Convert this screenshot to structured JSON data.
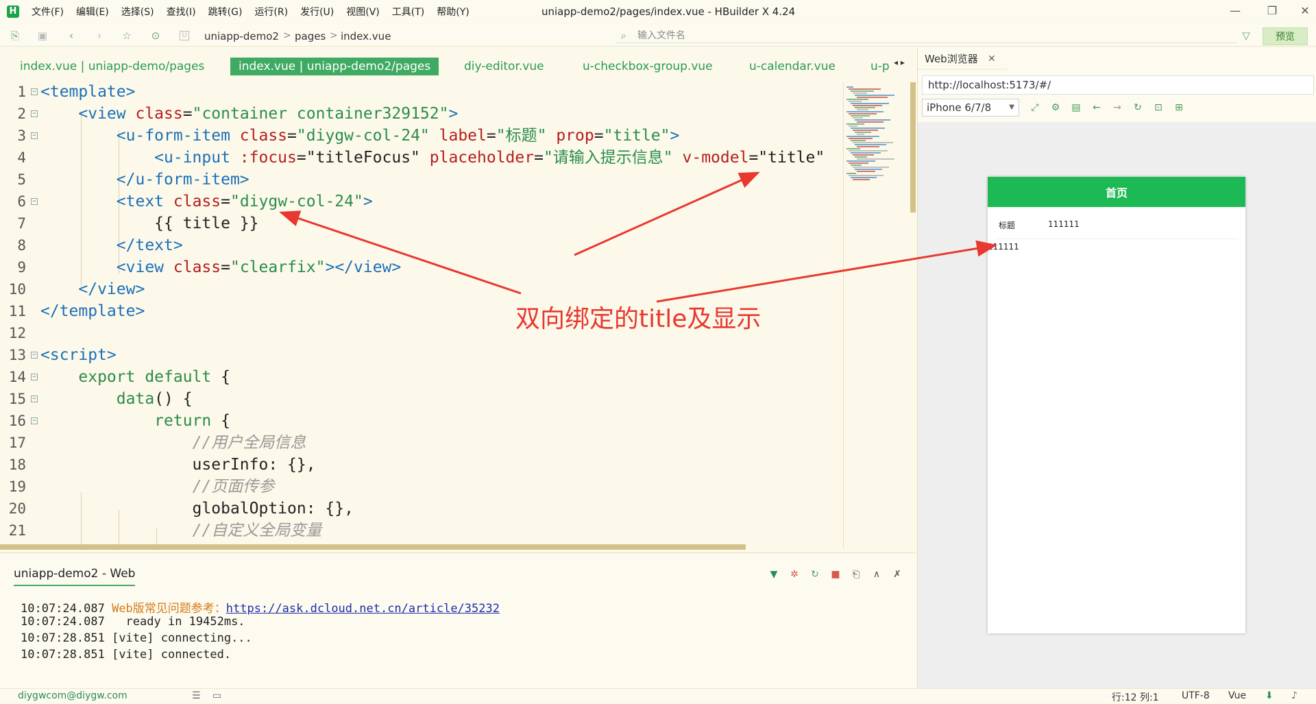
{
  "titlebar": {
    "logo": "H",
    "menu": [
      "文件(F)",
      "编辑(E)",
      "选择(S)",
      "查找(I)",
      "跳转(G)",
      "运行(R)",
      "发行(U)",
      "视图(V)",
      "工具(T)",
      "帮助(Y)"
    ],
    "window_title": "uniapp-demo2/pages/index.vue - HBuilder X 4.24",
    "minimize": "—",
    "restore": "❐",
    "close": "✕"
  },
  "toolbar": {
    "breadcrumb": [
      "uniapp-demo2",
      "pages",
      "index.vue"
    ],
    "breadcrumb_sep": ">",
    "search_placeholder": "输入文件名",
    "preview_label": "预览",
    "icons": [
      "new-file-icon",
      "save-icon",
      "back-icon",
      "forward-icon",
      "star-icon",
      "run-icon",
      "project-icon",
      "file-search-icon",
      "filter-icon"
    ]
  },
  "tabs": [
    {
      "label": "index.vue | uniapp-demo/pages",
      "active": false
    },
    {
      "label": "index.vue | uniapp-demo2/pages",
      "active": true
    },
    {
      "label": "diy-editor.vue",
      "active": false
    },
    {
      "label": "u-checkbox-group.vue",
      "active": false
    },
    {
      "label": "u-calendar.vue",
      "active": false
    },
    {
      "label": "u-p",
      "active": false
    }
  ],
  "tab_scroll": "◂ ▸",
  "code_lines": [
    {
      "n": "1",
      "fold": "⊟",
      "tokens": [
        [
          "tag",
          "<template>"
        ]
      ]
    },
    {
      "n": "2",
      "fold": "⊟",
      "tokens": [
        [
          "plain",
          "    "
        ],
        [
          "tag",
          "<view "
        ],
        [
          "attr",
          "class"
        ],
        [
          "plain",
          "="
        ],
        [
          "str",
          "\"container container329152\""
        ],
        [
          "tag",
          ">"
        ]
      ]
    },
    {
      "n": "3",
      "fold": "⊟",
      "tokens": [
        [
          "plain",
          "        "
        ],
        [
          "tag",
          "<u-form-item "
        ],
        [
          "attr",
          "class"
        ],
        [
          "plain",
          "="
        ],
        [
          "str",
          "\"diygw-col-24\""
        ],
        [
          "plain",
          " "
        ],
        [
          "attr",
          "label"
        ],
        [
          "plain",
          "="
        ],
        [
          "str",
          "\"标题\""
        ],
        [
          "plain",
          " "
        ],
        [
          "attr",
          "prop"
        ],
        [
          "plain",
          "="
        ],
        [
          "str",
          "\"title\""
        ],
        [
          "tag",
          ">"
        ]
      ]
    },
    {
      "n": "4",
      "fold": "",
      "tokens": [
        [
          "plain",
          "            "
        ],
        [
          "tag",
          "<u-input "
        ],
        [
          "attr",
          ":focus"
        ],
        [
          "plain",
          "=\"titleFocus\" "
        ],
        [
          "attr",
          "placeholder"
        ],
        [
          "plain",
          "="
        ],
        [
          "str",
          "\"请输入提示信息\""
        ],
        [
          "plain",
          " "
        ],
        [
          "attr",
          "v-model"
        ],
        [
          "plain",
          "=\"title\""
        ]
      ]
    },
    {
      "n": "5",
      "fold": "",
      "tokens": [
        [
          "plain",
          "        "
        ],
        [
          "tag",
          "</u-form-item>"
        ]
      ]
    },
    {
      "n": "6",
      "fold": "⊟",
      "tokens": [
        [
          "plain",
          "        "
        ],
        [
          "tag",
          "<text "
        ],
        [
          "attr",
          "class"
        ],
        [
          "plain",
          "="
        ],
        [
          "str",
          "\"diygw-col-24\""
        ],
        [
          "tag",
          ">"
        ]
      ]
    },
    {
      "n": "7",
      "fold": "",
      "tokens": [
        [
          "plain",
          "            {{ title }}"
        ]
      ]
    },
    {
      "n": "8",
      "fold": "",
      "tokens": [
        [
          "plain",
          "        "
        ],
        [
          "tag",
          "</text>"
        ]
      ]
    },
    {
      "n": "9",
      "fold": "",
      "tokens": [
        [
          "plain",
          "        "
        ],
        [
          "tag",
          "<view "
        ],
        [
          "attr",
          "class"
        ],
        [
          "plain",
          "="
        ],
        [
          "str",
          "\"clearfix\""
        ],
        [
          "tag",
          "></view>"
        ]
      ]
    },
    {
      "n": "10",
      "fold": "",
      "tokens": [
        [
          "plain",
          "    "
        ],
        [
          "tag",
          "</view>"
        ]
      ]
    },
    {
      "n": "11",
      "fold": "",
      "tokens": [
        [
          "tag",
          "</template>"
        ]
      ]
    },
    {
      "n": "12",
      "fold": "",
      "tokens": [
        [
          "plain",
          ""
        ]
      ]
    },
    {
      "n": "13",
      "fold": "⊟",
      "tokens": [
        [
          "tag",
          "<script>"
        ]
      ]
    },
    {
      "n": "14",
      "fold": "⊟",
      "tokens": [
        [
          "plain",
          "    "
        ],
        [
          "kw",
          "export default"
        ],
        [
          "plain",
          " {"
        ]
      ]
    },
    {
      "n": "15",
      "fold": "⊟",
      "tokens": [
        [
          "plain",
          "        "
        ],
        [
          "kw",
          "data"
        ],
        [
          "plain",
          "() {"
        ]
      ]
    },
    {
      "n": "16",
      "fold": "⊟",
      "tokens": [
        [
          "plain",
          "            "
        ],
        [
          "kw",
          "return"
        ],
        [
          "plain",
          " {"
        ]
      ]
    },
    {
      "n": "17",
      "fold": "",
      "tokens": [
        [
          "plain",
          "                "
        ],
        [
          "cmt",
          "//用户全局信息"
        ]
      ]
    },
    {
      "n": "18",
      "fold": "",
      "tokens": [
        [
          "plain",
          "                userInfo: {},"
        ]
      ]
    },
    {
      "n": "19",
      "fold": "",
      "tokens": [
        [
          "plain",
          "                "
        ],
        [
          "cmt",
          "//页面传参"
        ]
      ]
    },
    {
      "n": "20",
      "fold": "",
      "tokens": [
        [
          "plain",
          "                globalOption: {},"
        ]
      ]
    },
    {
      "n": "21",
      "fold": "",
      "tokens": [
        [
          "plain",
          "                "
        ],
        [
          "cmt",
          "//自定义全局变量"
        ]
      ]
    }
  ],
  "annotation": {
    "label": "双向绑定的title及显示",
    "color": "#e8382f"
  },
  "console": {
    "tab_label": "uniapp-demo2 - Web",
    "lines": [
      {
        "time": "10:07:24.087",
        "prefix": "Web版常见问题参考：",
        "link": "https://ask.dcloud.net.cn/article/35232",
        "text": ""
      },
      {
        "time": "10:07:24.087",
        "prefix": "",
        "link": "",
        "text": "  ready in 19452ms."
      },
      {
        "time": "10:07:28.851",
        "prefix": "",
        "link": "",
        "text": "[vite] connecting..."
      },
      {
        "time": "10:07:28.851",
        "prefix": "",
        "link": "",
        "text": "[vite] connected."
      }
    ]
  },
  "statusbar": {
    "user": "diygwcom@diygw.com",
    "cursor": "行:12  列:1",
    "encoding": "UTF-8",
    "language": "Vue"
  },
  "browser": {
    "tab_label": "Web浏览器",
    "tab_close": "✕",
    "url": "http://localhost:5173/#/",
    "device": "iPhone 6/7/8",
    "page_title": "首页",
    "form_label": "标题",
    "form_value": "111111",
    "text_display": "111111"
  },
  "colors": {
    "accent": "#3eaa62",
    "phone_header": "#1db954",
    "editor_bg": "#fcf9ea"
  }
}
